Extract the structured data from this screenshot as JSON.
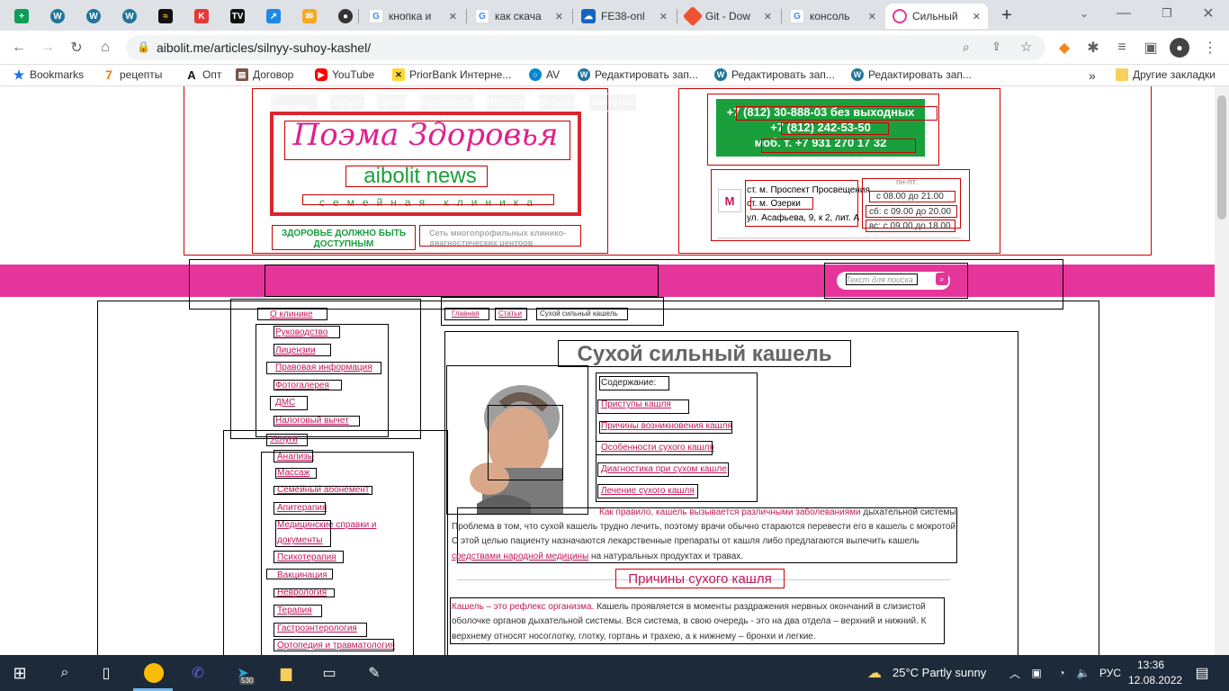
{
  "browser": {
    "tabs": [
      {
        "label": "",
        "icon": "sheets-icon",
        "color": "#0f9d58"
      },
      {
        "label": "",
        "icon": "wordpress-icon",
        "color": "#21759b"
      },
      {
        "label": "",
        "icon": "wordpress-icon",
        "color": "#21759b"
      },
      {
        "label": "",
        "icon": "wordpress-icon",
        "color": "#21759b"
      },
      {
        "label": "",
        "icon": "yandex-zen-icon",
        "color": "#111"
      },
      {
        "label": "",
        "icon": "k-icon",
        "color": "#e53935"
      },
      {
        "label": "",
        "icon": "tv-icon",
        "color": "#111"
      },
      {
        "label": "",
        "icon": "arrow-app-icon",
        "color": "#1e88e5"
      },
      {
        "label": "",
        "icon": "mail-icon",
        "color": "#f9a825"
      },
      {
        "label": "",
        "icon": "github-icon",
        "color": "#333"
      },
      {
        "label": "кнопка и",
        "icon": "google-icon",
        "color": "#4285f4"
      },
      {
        "label": "как скача",
        "icon": "google-icon",
        "color": "#4285f4"
      },
      {
        "label": "FE38-onl",
        "icon": "cloud-icon",
        "color": "#1565c0"
      },
      {
        "label": "Git - Dow",
        "icon": "git-icon",
        "color": "#f05133"
      },
      {
        "label": "консоль",
        "icon": "google-icon",
        "color": "#4285f4"
      },
      {
        "label": "Сильный",
        "icon": "aibolit-icon",
        "color": "#e6359a"
      }
    ],
    "new_tab": "+",
    "url": "aibolit.me/articles/silnyy-suhoy-kashel/",
    "bookmarks": [
      {
        "label": "Bookmarks",
        "icon": "star-icon",
        "color": "#1a73e8"
      },
      {
        "label": "рецепты",
        "icon": "seven-icon",
        "color": "#f57c00"
      },
      {
        "label": "Опт",
        "icon": "a-icon",
        "color": "#111"
      },
      {
        "label": "Договор",
        "icon": "doc-icon",
        "color": "#795548"
      },
      {
        "label": "YouTube",
        "icon": "youtube-icon",
        "color": "#ff0000"
      },
      {
        "label": "PriorBank Интерне...",
        "icon": "priorbank-icon",
        "color": "#111"
      },
      {
        "label": "AV",
        "icon": "av-icon",
        "color": "#0288d1"
      },
      {
        "label": "Редактировать зап...",
        "icon": "wordpress-icon",
        "color": "#21759b"
      },
      {
        "label": "Редактировать зап...",
        "icon": "wordpress-icon",
        "color": "#21759b"
      },
      {
        "label": "Редактировать зап...",
        "icon": "wordpress-icon",
        "color": "#21759b"
      }
    ],
    "more_bookmarks": "»",
    "other_bookmarks": "Другие закладки"
  },
  "header": {
    "brand": "Поэма Здоровья",
    "news": "aibolit news",
    "family": "семейная клиника",
    "slogan": "ЗДОРОВЬЕ ДОЛЖНО БЫТЬ ДОСТУПНЫМ",
    "slogan2": "Сеть многопрофильных клинико-диагностических центров",
    "phones": [
      "+7 (812) 30-888-03 без выходных",
      "+7 (812) 242-53-50",
      "моб. т. +7 931 270 17 32"
    ],
    "metro_icon": "M",
    "addresses": [
      "ст. м. Проспект Просвещения",
      "ст. м. Озерки",
      "ул. Асафьева, 9, к 2, лит. А"
    ],
    "hours_title": "пн-пт:",
    "hours": [
      "с 08.00 до 21.00",
      "сб:  с 09.00 до 20.00",
      "вс:  с 09.00 до 18.00"
    ]
  },
  "nav": {
    "items": [
      "О клинике",
      "Услуги",
      "Врачи",
      "Программы",
      "Новости",
      "Отзывы",
      "Контакты"
    ],
    "search_placeholder": "Текст для поиска",
    "accent": "#e6359a"
  },
  "sidebar": {
    "section1": "О клинике",
    "items1": [
      "Руководство",
      "Лицензии",
      "Правовая информация",
      "Фотогалерея",
      "ДМС",
      "Налоговый вычет"
    ],
    "section2": "Услуги",
    "items2": [
      "Анализы",
      "Массаж",
      "Семейный абонемент",
      "Апитерапия",
      "Медицинские справки и",
      "документы",
      "Психотерапия",
      "Вакцинация",
      "Неврология",
      "Терапия",
      "Гастроэнтерология",
      "Ортопедия и травматология"
    ]
  },
  "breadcrumbs": [
    "Главная",
    "Статьи",
    "Сухой сильный кашель"
  ],
  "article": {
    "title": "Сухой сильный кашель",
    "toc_title": "Содержание:",
    "toc": [
      "Приступы кашля",
      "Причины возникновения кашля",
      "Особенности сухого кашля",
      "Диагностика при сухом кашле",
      "Лечение сухого кашля"
    ],
    "p1_link": "Как правило, кашель вызывается различными заболеваниями",
    "p1_rest": " дыхательной системы.",
    "p2": "Проблема в том, что сухой кашель трудно лечить, поэтому врачи обычно стараются перевести его в кашель с мокротой.",
    "p3": "С этой целью пациенту назначаются лекарственные препараты от кашля либо предлагаются вылечить кашель",
    "p4_link": "средствами народной медицины",
    "p4_rest": " на натуральных продуктах и травах.",
    "h2": "Причины сухого кашля",
    "p5_link": "Кашель – это рефлекс организма.",
    "p5_rest": " Кашель проявляется в моменты раздражения нервных окончаний в слизистой",
    "p6": "оболочке органов дыхательной системы. Вся система, в свою очередь - это на два отдела – верхний и нижний. К",
    "p7": "верхнему относят носоглотку, глотку, гортань и трахею, а к нижнему – бронхи и легкие."
  },
  "taskbar": {
    "weather": "25°C  Partly sunny",
    "lang": "РУС",
    "time": "13:36",
    "date": "12.08.2022",
    "telegram_badge": "530"
  }
}
